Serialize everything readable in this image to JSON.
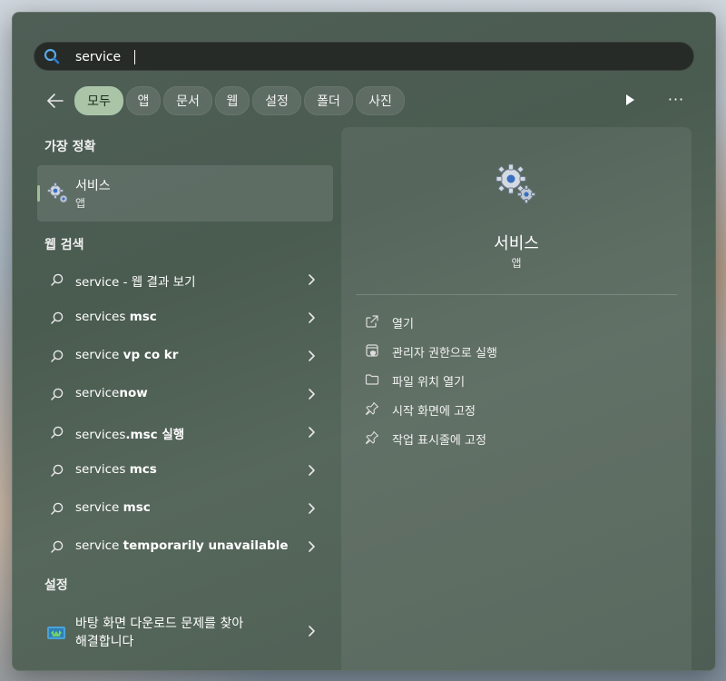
{
  "search": {
    "value": "service"
  },
  "filters": {
    "back": "back-arrow-icon",
    "chips": [
      "모두",
      "앱",
      "문서",
      "웹",
      "설정",
      "폴더",
      "사진"
    ],
    "active_index": 0,
    "more_label": "···"
  },
  "best_match": {
    "title": "가장 정확",
    "name": "서비스",
    "type": "앱"
  },
  "web_search": {
    "title": "웹 검색",
    "items": [
      {
        "prefix": "service - 웹 결과 보기",
        "bold": ""
      },
      {
        "prefix": "services ",
        "bold": "msc"
      },
      {
        "prefix": "service ",
        "bold": "vp co kr"
      },
      {
        "prefix": "service",
        "bold": "now"
      },
      {
        "prefix": "services",
        "bold": ".msc 실행"
      },
      {
        "prefix": "services ",
        "bold": "mcs"
      },
      {
        "prefix": "service ",
        "bold": "msc"
      },
      {
        "prefix": "service ",
        "bold": "temporarily unavailable"
      }
    ]
  },
  "settings": {
    "title": "설정",
    "item_line1": "바탕 화면 다운로드 문제를 찾아",
    "item_line2": "해결합니다"
  },
  "detail": {
    "name": "서비스",
    "type": "앱",
    "actions": [
      {
        "label": "열기",
        "icon": "open-external-icon"
      },
      {
        "label": "관리자 권한으로 실행",
        "icon": "run-as-admin-icon"
      },
      {
        "label": "파일 위치 열기",
        "icon": "folder-icon"
      },
      {
        "label": "시작 화면에 고정",
        "icon": "pin-icon"
      },
      {
        "label": "작업 표시줄에 고정",
        "icon": "pin-icon"
      }
    ]
  },
  "colors": {
    "panel": "#4f5f56",
    "search_bg": "#262b27",
    "active_chip": "#a9c4a7",
    "accent": "#9fbf97",
    "search_icon": "#5aa9e6"
  }
}
